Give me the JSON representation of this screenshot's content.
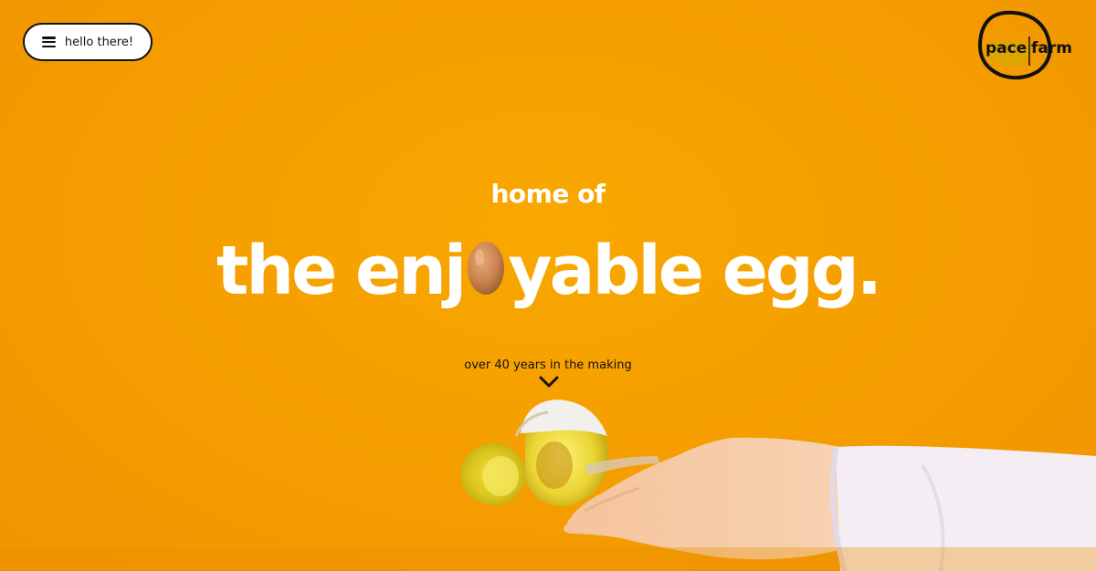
{
  "header": {
    "menu_label": "hello there!",
    "logo": {
      "word1": "pace",
      "word2": "farm"
    }
  },
  "hero": {
    "subtitle": "home of",
    "headline_before": "the enj",
    "headline_after": "yable egg.",
    "tagline": "over 40 years in the making"
  },
  "colors": {
    "background": "#f59d00",
    "text_light": "#ffffff",
    "text_dark": "#111111",
    "logo_accent": "#e0a500"
  },
  "icons": {
    "menu": "hamburger-icon",
    "scroll": "chevron-down-icon",
    "egg": "egg-icon"
  }
}
